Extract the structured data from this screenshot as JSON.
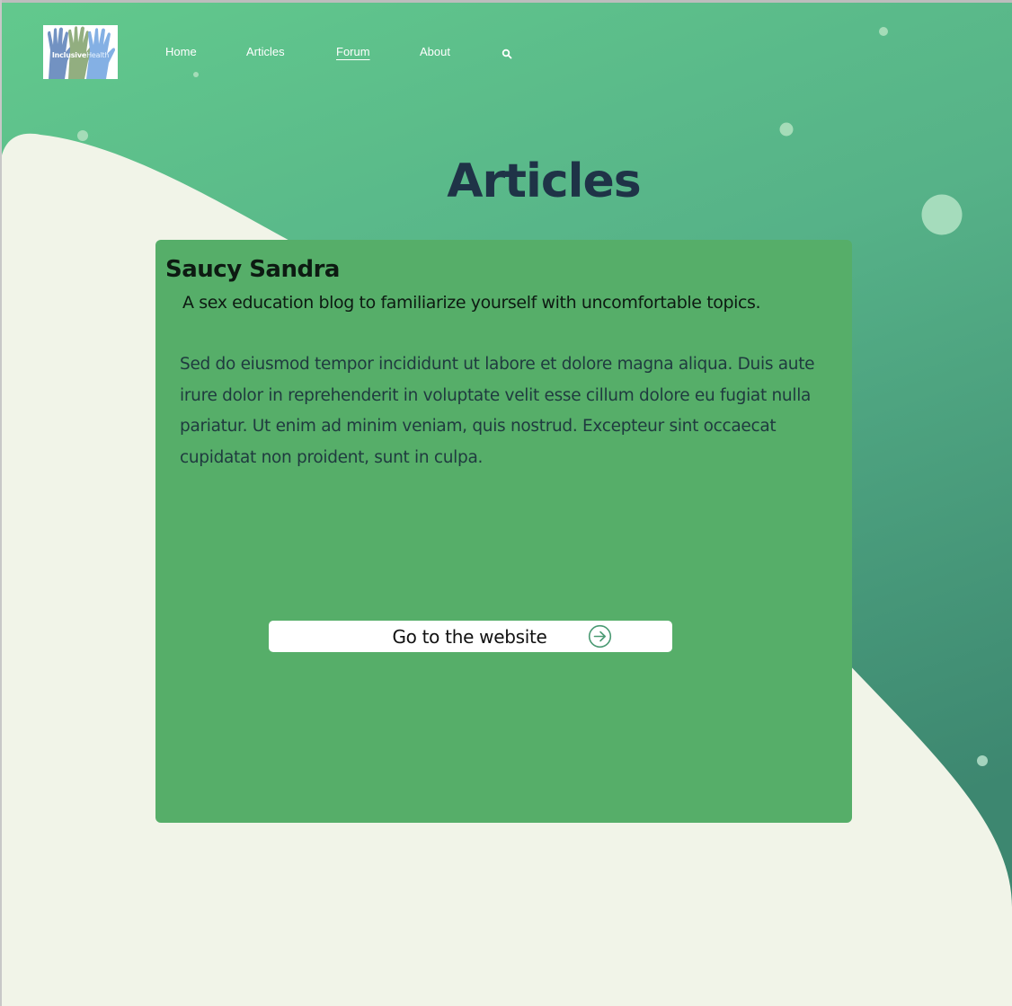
{
  "logo": {
    "text_bold": "Inclusive",
    "text_light": "Health"
  },
  "nav": {
    "items": [
      {
        "label": "Home",
        "active": false
      },
      {
        "label": "Articles",
        "active": false
      },
      {
        "label": "Forum",
        "active": true
      },
      {
        "label": "About",
        "active": false
      }
    ],
    "search_icon": "search-icon"
  },
  "page": {
    "title": "Articles"
  },
  "article": {
    "title": "Saucy Sandra",
    "subtitle": "A sex education blog to familiarize yourself with uncomfortable topics.",
    "body": "Sed do eiusmod tempor incididunt ut labore et dolore magna aliqua. Duis aute irure dolor in reprehenderit in voluptate velit esse cillum dolore eu fugiat nulla pariatur. Ut enim ad minim veniam, quis nostrud. Excepteur sint occaecat cupidatat non proident, sunt in culpa.",
    "button_label": "Go to the website",
    "button_icon": "arrow-right-circle-icon"
  },
  "colors": {
    "gradient_top": "#62c78d",
    "gradient_bottom": "#3f8a6f",
    "page_background": "#f1f4e8",
    "card_background": "#56ae69",
    "title_color": "#1f3347",
    "accent": "#4a9a73"
  }
}
